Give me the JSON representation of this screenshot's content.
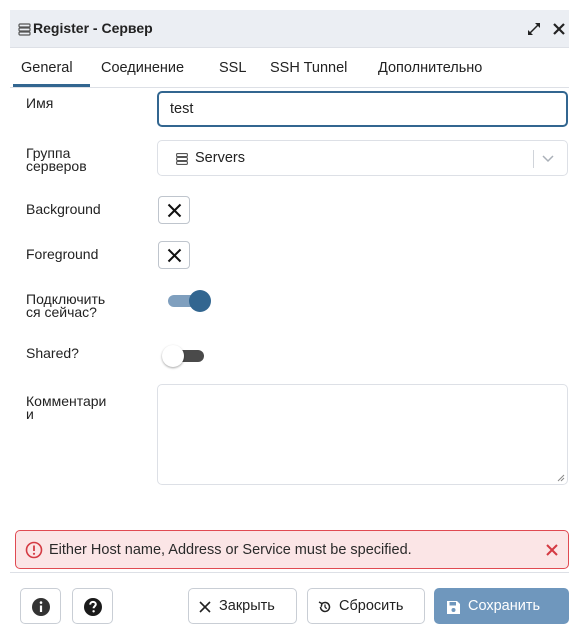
{
  "dialog": {
    "title": "Register - Сервер"
  },
  "tabs": [
    {
      "label": "General",
      "active": true
    },
    {
      "label": "Соединение",
      "active": false
    },
    {
      "label": "SSL",
      "active": false
    },
    {
      "label": "SSH Tunnel",
      "active": false
    },
    {
      "label": "Дополнительно",
      "active": false
    }
  ],
  "form": {
    "name_label": "Имя",
    "name_value": "test",
    "group_label_line1": "Группа",
    "group_label_line2": "серверов",
    "group_value": "Servers",
    "background_label": "Background",
    "background_checked": true,
    "foreground_label": "Foreground",
    "foreground_checked": true,
    "connect_label_line1": "Подключить",
    "connect_label_line2": "ся сейчас?",
    "connect_now": true,
    "shared_label": "Shared?",
    "shared": false,
    "comments_label_line1": "Комментари",
    "comments_label_line2": "и",
    "comments_value": ""
  },
  "error": {
    "message": "Either Host name, Address or Service must be specified."
  },
  "footer": {
    "close_label": "Закрыть",
    "reset_label": "Сбросить",
    "save_label": "Сохранить"
  },
  "icons": {
    "server": "server-icon",
    "maximize": "maximize-icon",
    "close": "close-icon",
    "info": "info-icon",
    "help": "help-icon",
    "reset": "reset-icon",
    "save": "save-icon",
    "error": "error-icon"
  },
  "colors": {
    "accent": "#326690",
    "toggle_on_knob": "#326690",
    "toggle_on_track": "#7f9fbe",
    "error_border": "#e04a52",
    "error_bg": "#fbe5e6",
    "save_button": "#6f97bd"
  }
}
